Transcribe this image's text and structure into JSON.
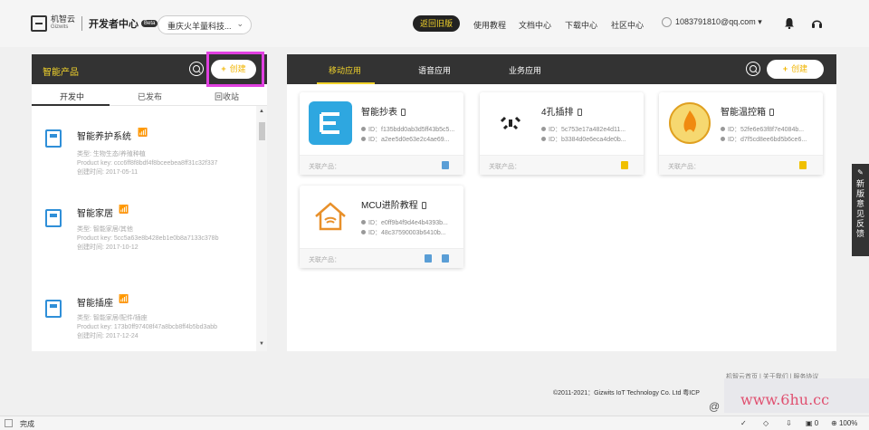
{
  "header": {
    "logo_cn": "机智云",
    "logo_en": "Gizwits",
    "dev_center": "开发者中心",
    "beta": "Beta",
    "company": "重庆火羊量科技...",
    "back_old": "返回旧版",
    "nav": [
      "使用教程",
      "文档中心",
      "下载中心",
      "社区中心"
    ],
    "account": "1083791810@qq.com ▾"
  },
  "left": {
    "title": "智能产品",
    "create": "创建",
    "tabs": [
      "开发中",
      "已发布",
      "回收站"
    ],
    "products": [
      {
        "name": "智能养护系统",
        "meta1": "类型: 生物生态/养殖种植",
        "meta2": "Product key: ccc6ff8f8bdf4f8bceebea8ff31c32f337",
        "meta3": "创建时间: 2017-05-11"
      },
      {
        "name": "智能家居",
        "meta1": "类型: 智能家居/其他",
        "meta2": "Product key: 5cc5a63e8b428eb1e0b8a7133c378b",
        "meta3": "创建时间: 2017-10-12"
      },
      {
        "name": "智能插座",
        "meta1": "类型: 智能家居/配件/插座",
        "meta2": "Product key: 173b0ff97408f47a8bcb8ff4b5bd3abb",
        "meta3": "创建时间: 2017-12-24"
      }
    ]
  },
  "right": {
    "tabs": [
      "移动应用",
      "语音应用",
      "业务应用"
    ],
    "create": "创建",
    "cards": [
      {
        "name": "智能抄表",
        "id1": "ID：f135bdd0ab3d5ff43b5c5...",
        "id2": "ID：a2ee5d0e63e2c4ae69...",
        "foot": "关联产品："
      },
      {
        "name": "4孔插排",
        "id1": "ID：5c753e17a482e4d11...",
        "id2": "ID：b3384d0e6eca4de0b...",
        "foot": "关联产品："
      },
      {
        "name": "智能温控箱",
        "id1": "ID：52fe6e63f8f7e4084b...",
        "id2": "ID：d7f5cd8ee6bd5b6ce6...",
        "foot": "关联产品："
      },
      {
        "name": "MCU进阶教程",
        "id1": "ID：e0ff9b4f9d4e4b4393b...",
        "id2": "ID：48c37590003b6410b...",
        "foot": "关联产品："
      }
    ]
  },
  "feedback": [
    "新",
    "版",
    "意",
    "见",
    "反",
    "馈"
  ],
  "footer": {
    "links": "机智云首页 | 关于我们 | 服务协议",
    "copyright": "©2011-2021：Gizwits IoT Technology Co. Ltd 粤ICP",
    "watermark": "www.6hu.cc",
    "at": "@"
  },
  "statusbar": {
    "status": "完成",
    "zoom": "100%",
    "count": "0"
  }
}
